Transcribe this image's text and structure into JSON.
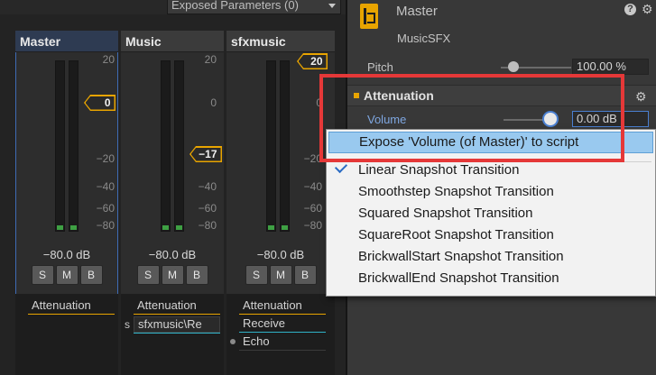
{
  "mixer": {
    "exposed_params_label": "Exposed Parameters (0)",
    "scale_ticks": [
      "20",
      "0",
      "−20",
      "−40",
      "−60",
      "−80"
    ],
    "strips": [
      {
        "name": "Master",
        "level": "−80.0 dB",
        "fader_value": "0",
        "buttons": [
          "S",
          "M",
          "B"
        ],
        "effects": [
          "Attenuation"
        ]
      },
      {
        "name": "Music",
        "level": "−80.0 dB",
        "fader_value": "−17",
        "buttons": [
          "S",
          "M",
          "B"
        ],
        "effects": [
          "Attenuation"
        ],
        "send_prefix": "s",
        "send_value": "sfxmusic\\Re"
      },
      {
        "name": "sfxmusic",
        "level": "−80.0 dB",
        "fader_value": "20",
        "buttons": [
          "S",
          "M",
          "B"
        ],
        "effects": [
          "Attenuation",
          "Receive",
          "Echo"
        ]
      }
    ]
  },
  "inspector": {
    "title": "Master",
    "subtitle": "MusicSFX",
    "pitch_label": "Pitch",
    "pitch_value": "100.00 %",
    "section_title": "Attenuation",
    "volume_label": "Volume",
    "volume_value": "0.00 dB",
    "colors": {
      "accent": "#e8a400",
      "highlight": "#e53838",
      "menu_hover": "#99c9ef"
    }
  },
  "context_menu": {
    "items": [
      {
        "label": "Expose 'Volume (of Master)' to script",
        "highlighted": true
      },
      {
        "label": "Linear Snapshot Transition",
        "checked": true
      },
      {
        "label": "Smoothstep Snapshot Transition"
      },
      {
        "label": "Squared Snapshot Transition"
      },
      {
        "label": "SquareRoot Snapshot Transition"
      },
      {
        "label": "BrickwallStart Snapshot Transition"
      },
      {
        "label": "BrickwallEnd Snapshot Transition"
      }
    ]
  }
}
